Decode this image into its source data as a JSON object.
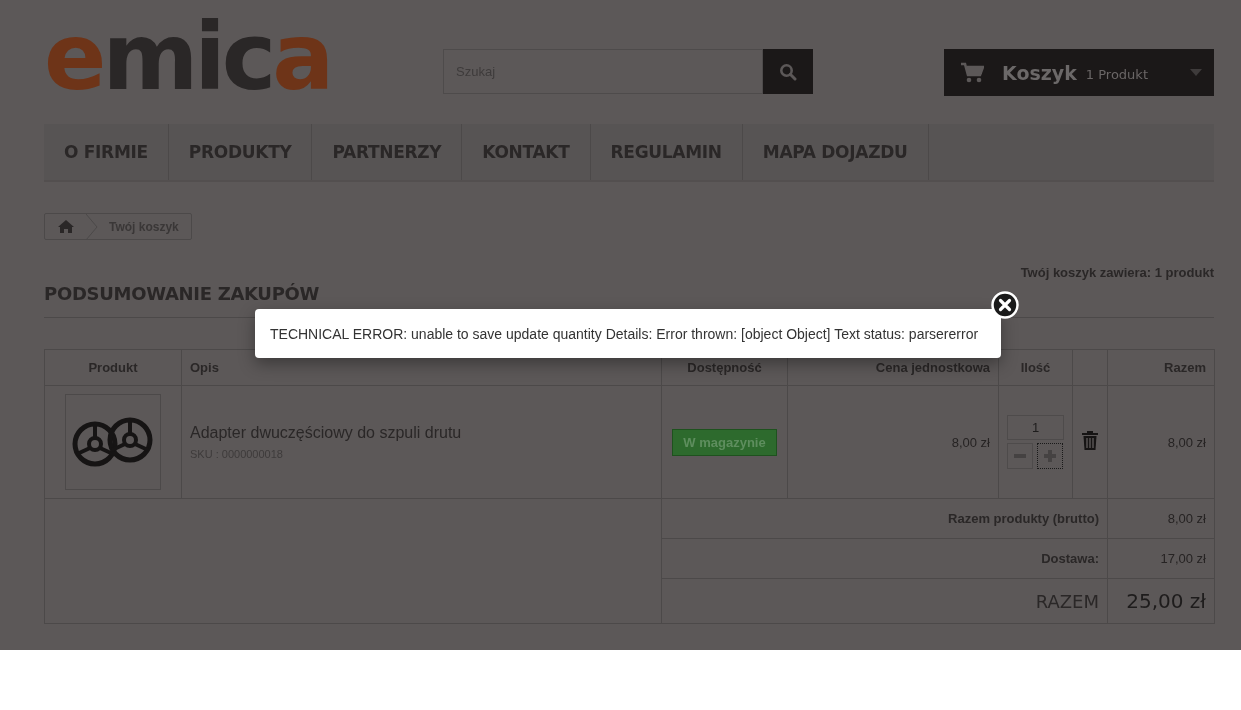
{
  "logo": {
    "letters": [
      {
        "text": "e",
        "color": "#6e3418"
      },
      {
        "text": "mic",
        "color": "#2a2727"
      },
      {
        "text": "a",
        "color": "#6e3418"
      }
    ]
  },
  "search": {
    "placeholder": "Szukaj"
  },
  "cart": {
    "label": "Koszyk",
    "count": "1 Produkt"
  },
  "nav": [
    {
      "label": "O FIRMIE"
    },
    {
      "label": "PRODUKTY"
    },
    {
      "label": "PARTNERZY"
    },
    {
      "label": "KONTAKT"
    },
    {
      "label": "REGULAMIN"
    },
    {
      "label": "MAPA DOJAZDU"
    }
  ],
  "breadcrumb": {
    "current": "Twój koszyk"
  },
  "heading": "PODSUMOWANIE ZAKUPÓW",
  "cart_summary": "Twój koszyk zawiera: 1 produkt",
  "table": {
    "columns": [
      "Produkt",
      "Opis",
      "Dostępność",
      "Cena jednostkowa",
      "Ilość",
      "Razem"
    ],
    "rows": [
      {
        "name": "Adapter dwuczęściowy do szpuli drutu",
        "sku": "SKU : 0000000018",
        "availability": "W magazynie",
        "unit_price": "8,00 zł",
        "quantity": "1",
        "total": "8,00 zł"
      }
    ],
    "summary": [
      {
        "kind": "normal",
        "label": "Razem produkty (brutto)",
        "value": "8,00 zł"
      },
      {
        "kind": "normal",
        "label": "Dostawa:",
        "value": "17,00 zł"
      },
      {
        "kind": "grand",
        "label": "RAZEM",
        "value": "25,00 zł"
      }
    ]
  },
  "error_dialog": {
    "message": "TECHNICAL ERROR: unable to save update quantity Details: Error thrown: [object Object] Text status: parsererror"
  }
}
